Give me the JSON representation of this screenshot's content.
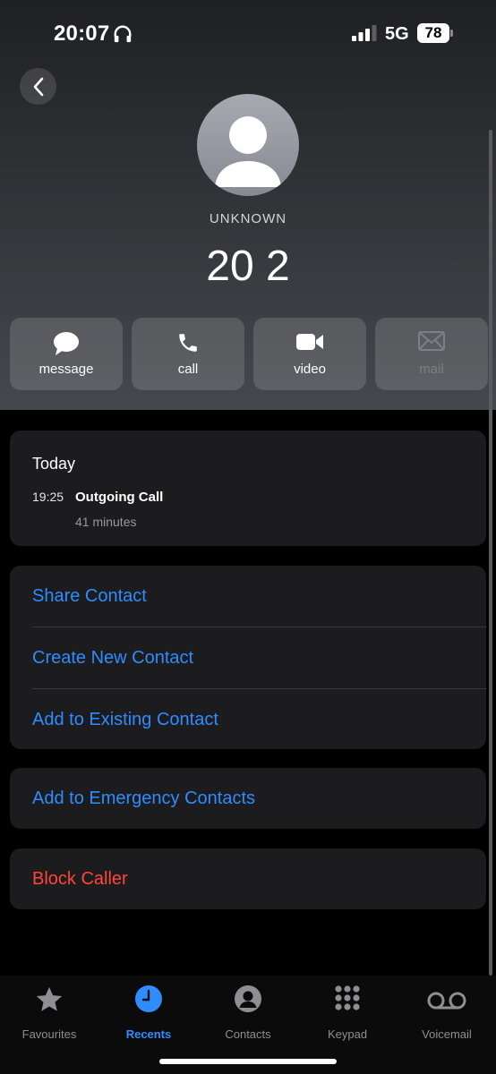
{
  "status_bar": {
    "time": "20:07",
    "headphone_icon": "headphones-icon",
    "network": "5G",
    "battery": "78"
  },
  "header": {
    "back_icon": "chevron-left-icon",
    "contact_label": "UNKNOWN",
    "number": "20 2"
  },
  "actions": [
    {
      "label": "message",
      "icon": "message-bubble-icon",
      "enabled": true
    },
    {
      "label": "call",
      "icon": "phone-icon",
      "enabled": true
    },
    {
      "label": "video",
      "icon": "video-camera-icon",
      "enabled": true
    },
    {
      "label": "mail",
      "icon": "envelope-icon",
      "enabled": false
    }
  ],
  "call_history": {
    "title": "Today",
    "entries": [
      {
        "time": "19:25",
        "type": "Outgoing Call",
        "duration": "41 minutes"
      }
    ]
  },
  "contact_options": {
    "share": "Share Contact",
    "create": "Create New Contact",
    "add_existing": "Add to Existing Contact"
  },
  "emergency": {
    "add": "Add to Emergency Contacts"
  },
  "block": {
    "label": "Block Caller"
  },
  "tab_bar": {
    "tabs": [
      {
        "label": "Favourites",
        "icon": "star-icon",
        "active": false
      },
      {
        "label": "Recents",
        "icon": "clock-icon",
        "active": true
      },
      {
        "label": "Contacts",
        "icon": "person-circle-icon",
        "active": false
      },
      {
        "label": "Keypad",
        "icon": "keypad-icon",
        "active": false
      },
      {
        "label": "Voicemail",
        "icon": "voicemail-icon",
        "active": false
      }
    ]
  },
  "colors": {
    "accent": "#2f8cff",
    "destructive": "#ff453a",
    "card": "#1c1c1e"
  }
}
